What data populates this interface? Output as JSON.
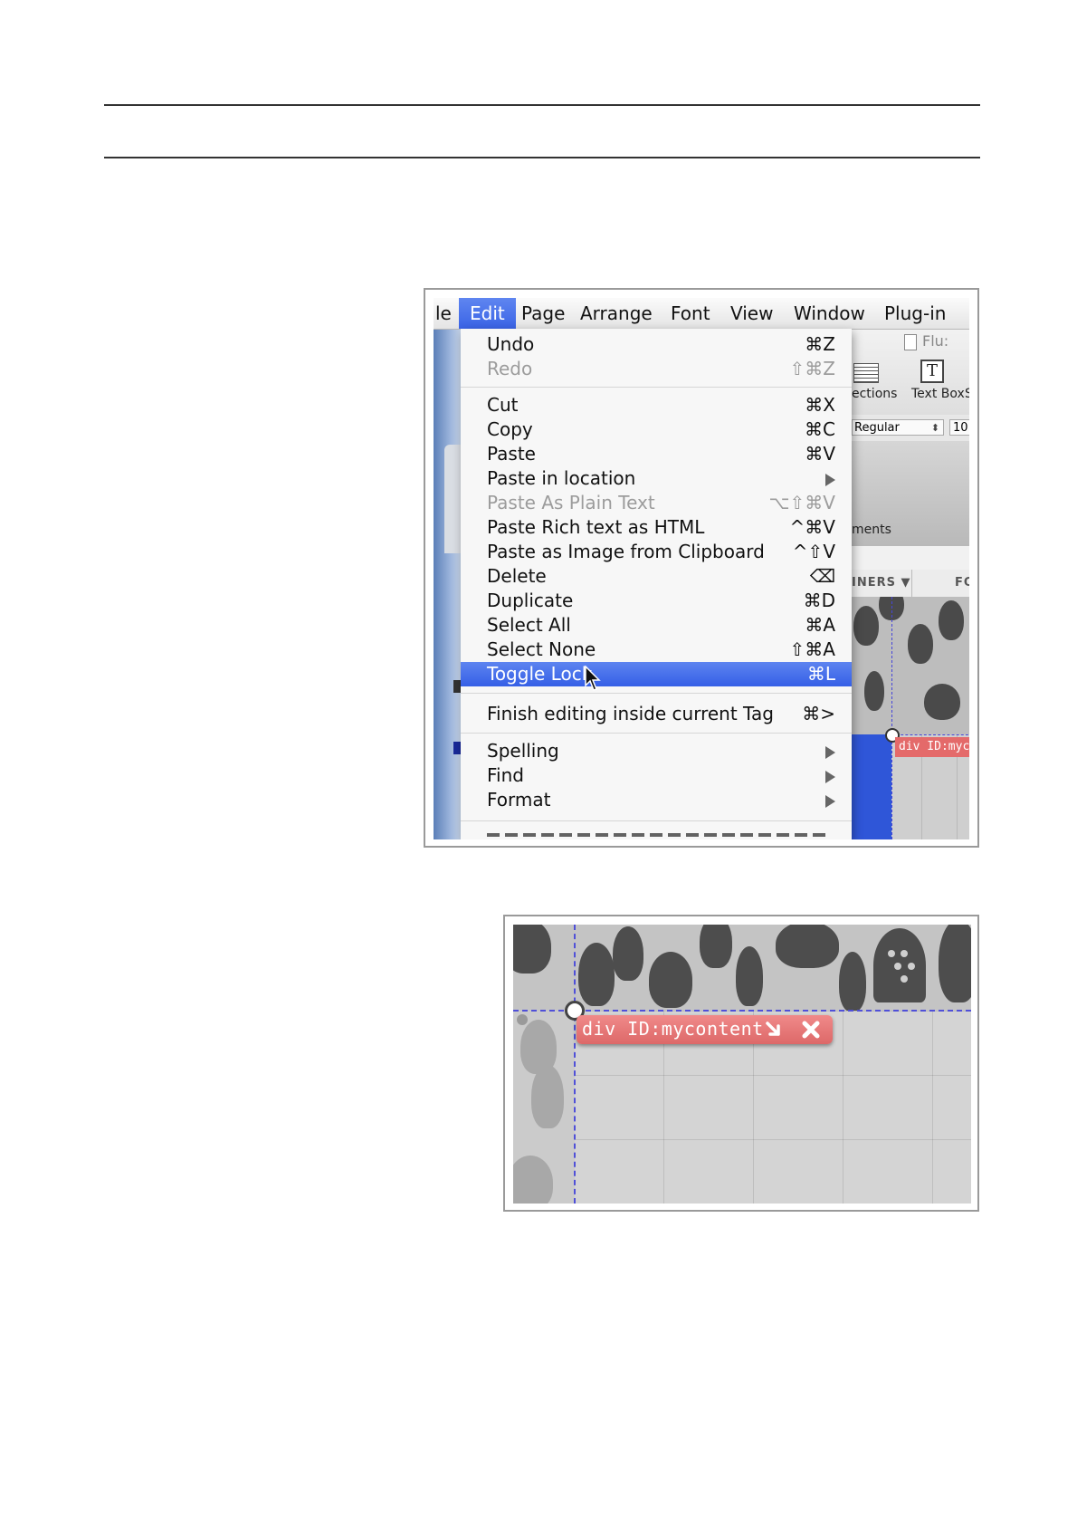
{
  "figure1": {
    "menubar": [
      {
        "label": "le"
      },
      {
        "label": "Edit"
      },
      {
        "label": "Page"
      },
      {
        "label": "Arrange"
      },
      {
        "label": "Font"
      },
      {
        "label": "View"
      },
      {
        "label": "Window"
      },
      {
        "label": "Plug-in"
      }
    ],
    "background_app": {
      "window_title": "Flu:",
      "sections_label": "ections",
      "textbox_label": "Text Box",
      "textbox_icon_glyph": "T",
      "extra_label": "S",
      "font_style": "Regular",
      "font_size": "10",
      "elements_label": "ments",
      "column_header_1": "INERS ▼",
      "column_header_2": "FO",
      "tag_label": "div ID:myco"
    },
    "edit_menu": {
      "items": [
        {
          "label": "Undo",
          "shortcut": "⌘Z",
          "disabled": false
        },
        {
          "label": "Redo",
          "shortcut": "⇧⌘Z",
          "disabled": true
        },
        {
          "label": "Cut",
          "shortcut": "⌘X",
          "disabled": false
        },
        {
          "label": "Copy",
          "shortcut": "⌘C",
          "disabled": false
        },
        {
          "label": "Paste",
          "shortcut": "⌘V",
          "disabled": false
        },
        {
          "label": "Paste in location",
          "shortcut": "",
          "submenu": true,
          "disabled": false
        },
        {
          "label": "Paste As Plain Text",
          "shortcut": "⌥⇧⌘V",
          "disabled": true
        },
        {
          "label": "Paste Rich text as HTML",
          "shortcut": "^⌘V",
          "disabled": false
        },
        {
          "label": "Paste as Image from Clipboard",
          "shortcut": "^⇧V",
          "disabled": false
        },
        {
          "label": "Delete",
          "shortcut": "⌫",
          "disabled": false
        },
        {
          "label": "Duplicate",
          "shortcut": "⌘D",
          "disabled": false
        },
        {
          "label": "Select All",
          "shortcut": "⌘A",
          "disabled": false
        },
        {
          "label": "Select None",
          "shortcut": "⇧⌘A",
          "disabled": false
        },
        {
          "label": "Toggle Lock",
          "shortcut": "⌘L",
          "highlighted": true,
          "disabled": false
        },
        {
          "label": "Finish editing inside current Tag",
          "shortcut": "⌘>",
          "disabled": false
        },
        {
          "label": "Spelling",
          "shortcut": "",
          "submenu": true,
          "disabled": false
        },
        {
          "label": "Find",
          "shortcut": "",
          "submenu": true,
          "disabled": false
        },
        {
          "label": "Format",
          "shortcut": "",
          "submenu": true,
          "disabled": false
        }
      ]
    },
    "colors": {
      "menu_highlight": "#3a63e6",
      "selection_blue": "#2f56d8",
      "guide_line": "#5050d8"
    }
  },
  "figure2": {
    "tag_label": "div ID:mycontent",
    "icons": [
      "arrow-down-right-icon",
      "close-x-icon"
    ],
    "colors": {
      "tag_bg": "#e57373",
      "guide_line": "#5050d8"
    }
  }
}
